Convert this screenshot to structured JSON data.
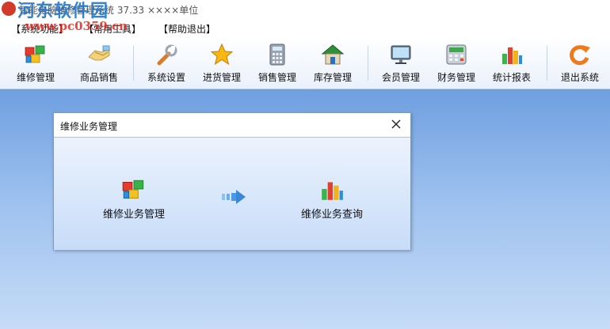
{
  "window": {
    "title": "智能电脑维修管理系统 37.33 ××××单位"
  },
  "watermark": {
    "title": "河东软件园",
    "url": "www.pc0359.cn"
  },
  "menubar": {
    "items": [
      "【系统功能】",
      "【常用工具】",
      "【帮助退出】"
    ]
  },
  "toolbar": {
    "items": [
      {
        "label": "维修管理",
        "icon": "repair-cubes-icon"
      },
      {
        "label": "商品销售",
        "icon": "handshake-icon"
      },
      {
        "label": "系统设置",
        "icon": "wrench-icon"
      },
      {
        "label": "进货管理",
        "icon": "star-icon"
      },
      {
        "label": "销售管理",
        "icon": "calculator-icon"
      },
      {
        "label": "库存管理",
        "icon": "house-icon"
      },
      {
        "label": "会员管理",
        "icon": "monitor-icon"
      },
      {
        "label": "财务管理",
        "icon": "cash-register-icon"
      },
      {
        "label": "统计报表",
        "icon": "bar-chart-icon"
      },
      {
        "label": "退出系统",
        "icon": "refresh-exit-icon"
      }
    ]
  },
  "dialog": {
    "title": "维修业务管理",
    "actions": [
      {
        "label": "维修业务管理",
        "icon": "repair-cubes-icon"
      },
      {
        "label": "维修业务查询",
        "icon": "bar-chart-icon"
      }
    ]
  },
  "colors": {
    "workspace_top": "#6e9fe0",
    "workspace_bottom": "#c6dcf7",
    "accent_blue": "#1e73c8",
    "watermark_red": "#e2261d"
  }
}
